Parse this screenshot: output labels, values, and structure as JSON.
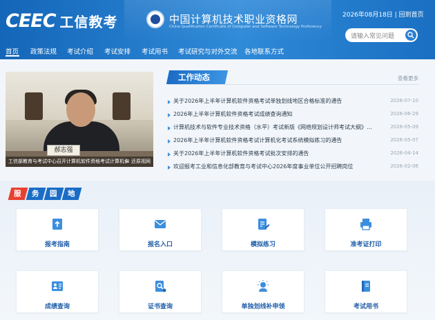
{
  "header": {
    "logo_latin": "CEEC",
    "logo_cn": "工信教考",
    "org_name": "中国计算机技术职业资格网",
    "org_en": "China Qualification Certificate of Computer and Software Technology Proficiency",
    "date_text": "2026年08月18日",
    "home_link": "回到首页",
    "search_placeholder": "请输入常见问题"
  },
  "nav": {
    "items": [
      "首页",
      "政策法规",
      "考试介绍",
      "考试安排",
      "考试用书",
      "考试研究与对外交流",
      "各地联系方式"
    ],
    "active_index": 0
  },
  "photo": {
    "nameplate": "郝志强",
    "caption": "工信部教育与考试中心召开计算机软件资格考试计算机化…",
    "more": "⊞ 还原视网"
  },
  "news": {
    "title": "工作动态",
    "more": "查看更多",
    "items": [
      {
        "text": "关于2026年上半年计算机软件资格考试单独划线地区合格标准的通告",
        "date": "2026-07-10"
      },
      {
        "text": "2026年上半年计算机软件资格考试成绩查询通知",
        "date": "2026-06-29"
      },
      {
        "text": "计算机技术与软件专业技术资格（水平）考试新版《网络规划设计师考试大纲》…",
        "date": "2026-05-09"
      },
      {
        "text": "2026年上半年计算机软件资格考试计算机化考试系统模拟练习的通告",
        "date": "2026-05-07"
      },
      {
        "text": "关于2026年上半年计算机软件资格考试批次安排的通告",
        "date": "2026-04-14"
      },
      {
        "text": "欢迎报考工业和信息化部教育与考试中心2026年度事业单位公开招聘岗位",
        "date": "2026-02-06"
      }
    ]
  },
  "services": {
    "heading_chars": [
      "服",
      "务",
      "园",
      "地"
    ],
    "heading_colors": [
      "#e8412f",
      "#1a6dc6",
      "#1a6dc6",
      "#1a6dc6"
    ],
    "cards": [
      {
        "label": "报考指南",
        "icon": "book-upload-icon"
      },
      {
        "label": "报名入口",
        "icon": "envelope-icon"
      },
      {
        "label": "模拟练习",
        "icon": "edit-document-icon"
      },
      {
        "label": "准考证打印",
        "icon": "printer-icon"
      },
      {
        "label": "成绩查询",
        "icon": "search-user-icon"
      },
      {
        "label": "证书查询",
        "icon": "document-search-icon"
      },
      {
        "label": "单独划线补申领",
        "icon": "lightbulb-user-icon"
      },
      {
        "label": "考试用书",
        "icon": "book-icon"
      }
    ],
    "accent": "#3b8ede"
  }
}
